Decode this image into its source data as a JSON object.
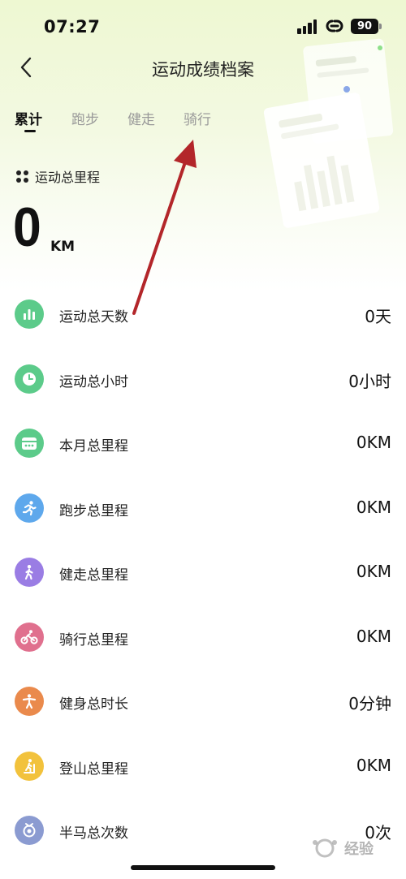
{
  "status_bar": {
    "time": "07:27",
    "battery": "90"
  },
  "header": {
    "title": "运动成绩档案"
  },
  "tabs": [
    {
      "label": "累计",
      "active": true
    },
    {
      "label": "跑步",
      "active": false
    },
    {
      "label": "健走",
      "active": false
    },
    {
      "label": "骑行",
      "active": false
    }
  ],
  "total": {
    "label": "运动总里程",
    "value": "0",
    "unit": "KM"
  },
  "stats": [
    {
      "label": "运动总天数",
      "value": "0天",
      "icon": "bar-chart-icon",
      "color": "#5ccb8a"
    },
    {
      "label": "运动总小时",
      "value": "0小时",
      "icon": "clock-icon",
      "color": "#5ccb8a"
    },
    {
      "label": "本月总里程",
      "value": "0KM",
      "icon": "calendar-icon",
      "color": "#5ccb8a"
    },
    {
      "label": "跑步总里程",
      "value": "0KM",
      "icon": "running-icon",
      "color": "#5ea8ec"
    },
    {
      "label": "健走总里程",
      "value": "0KM",
      "icon": "walking-icon",
      "color": "#9a7de4"
    },
    {
      "label": "骑行总里程",
      "value": "0KM",
      "icon": "cycling-icon",
      "color": "#e0708e"
    },
    {
      "label": "健身总时长",
      "value": "0分钟",
      "icon": "fitness-icon",
      "color": "#ea8a4c"
    },
    {
      "label": "登山总里程",
      "value": "0KM",
      "icon": "hiking-icon",
      "color": "#f2c23c"
    },
    {
      "label": "半马总次数",
      "value": "0次",
      "icon": "medal-icon",
      "color": "#8b9bd1"
    }
  ],
  "watermark": {
    "text": "经验"
  }
}
